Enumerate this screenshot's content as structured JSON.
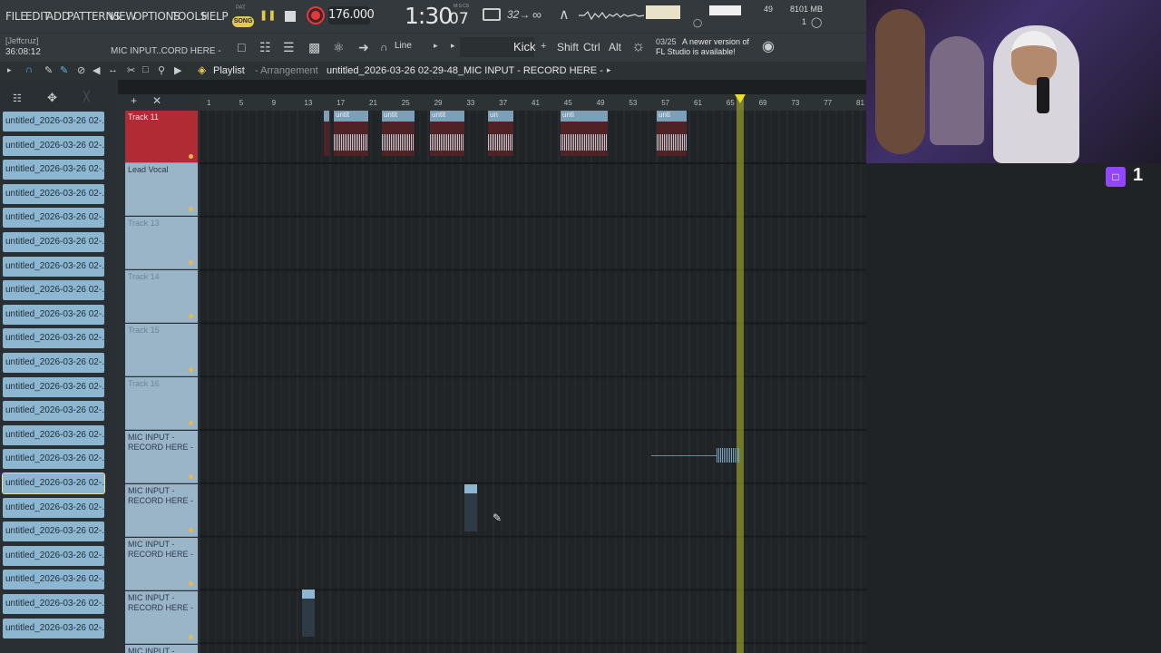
{
  "menu": {
    "items": [
      "FILE",
      "EDIT",
      "ADD",
      "PATTERNS",
      "VIEW",
      "OPTIONS",
      "TOOLS",
      "HELP"
    ]
  },
  "transport": {
    "pat_label": "PAT",
    "song_label": "SONG",
    "tempo": "176.000",
    "time_main": "1:30",
    "time_sub": "07",
    "time_unit": "M:S:CS",
    "step_label": "32",
    "cpu": "49",
    "ram": "8101 MB",
    "polyphony": "1"
  },
  "toolbar2": {
    "user_tag": "[Jeffcruz]",
    "clock": "36:08:12",
    "hint": "MIC INPUT..CORD HERE -",
    "snap": "Line",
    "channel": "Kick",
    "keys": [
      "Shift",
      "Ctrl",
      "Alt"
    ],
    "update_date": "03/25",
    "update_line1": "A newer version of",
    "update_line2": "FL Studio is available!"
  },
  "playlist": {
    "title": "Playlist",
    "separator_sub": "- Arrangement",
    "project": "untitled_2026-03-26 02-29-48_MIC INPUT - RECORD HERE -"
  },
  "browser": {
    "clips": [
      "untitled_2026-03-26 02-...",
      "untitled_2026-03-26 02-...",
      "untitled_2026-03-26 02-...",
      "untitled_2026-03-26 02-...",
      "untitled_2026-03-26 02-...",
      "untitled_2026-03-26 02-...",
      "untitled_2026-03-26 02-...",
      "untitled_2026-03-26 02-...",
      "untitled_2026-03-26 02-...",
      "untitled_2026-03-26 02-...",
      "untitled_2026-03-26 02-...",
      "untitled_2026-03-26 02-...",
      "untitled_2026-03-26 02-...",
      "untitled_2026-03-26 02-...",
      "untitled_2026-03-26 02-...",
      "untitled_2026-03-26 02-...",
      "untitled_2026-03-26 02-...",
      "untitled_2026-03-26 02-...",
      "untitled_2026-03-26 02-...",
      "untitled_2026-03-26 02-...",
      "untitled_2026-03-26 02-...",
      "untitled_2026-03-26 02-..."
    ]
  },
  "tracks": [
    {
      "name": "Track 11",
      "active": true
    },
    {
      "name": "Lead Vocal",
      "active": true
    },
    {
      "name": "Track 13",
      "active": false
    },
    {
      "name": "Track 14",
      "active": false
    },
    {
      "name": "Track 15",
      "active": false
    },
    {
      "name": "Track 16",
      "active": false
    },
    {
      "name": "MIC INPUT -\nRECORD HERE -",
      "active": true
    },
    {
      "name": "MIC INPUT -\nRECORD HERE -",
      "active": true
    },
    {
      "name": "MIC INPUT -\nRECORD HERE -",
      "active": true
    },
    {
      "name": "MIC INPUT -\nRECORD HERE -",
      "active": true
    },
    {
      "name": "MIC INPUT -",
      "active": true
    }
  ],
  "timeline": {
    "bars": [
      "1",
      "5",
      "9",
      "13",
      "17",
      "21",
      "25",
      "29",
      "33",
      "37",
      "41",
      "45",
      "49",
      "53",
      "57",
      "61",
      "65",
      "69",
      "73",
      "77",
      "81"
    ]
  },
  "clips_track11": [
    "untit",
    "untit",
    "untit",
    "un",
    "unti",
    "unti"
  ],
  "stream": {
    "viewer_count": "1"
  },
  "colors": {
    "accent_yellow": "#e4c948",
    "record_red": "#e2393f",
    "clip_blue": "#8db7d1",
    "twitch_purple": "#9146ff"
  }
}
